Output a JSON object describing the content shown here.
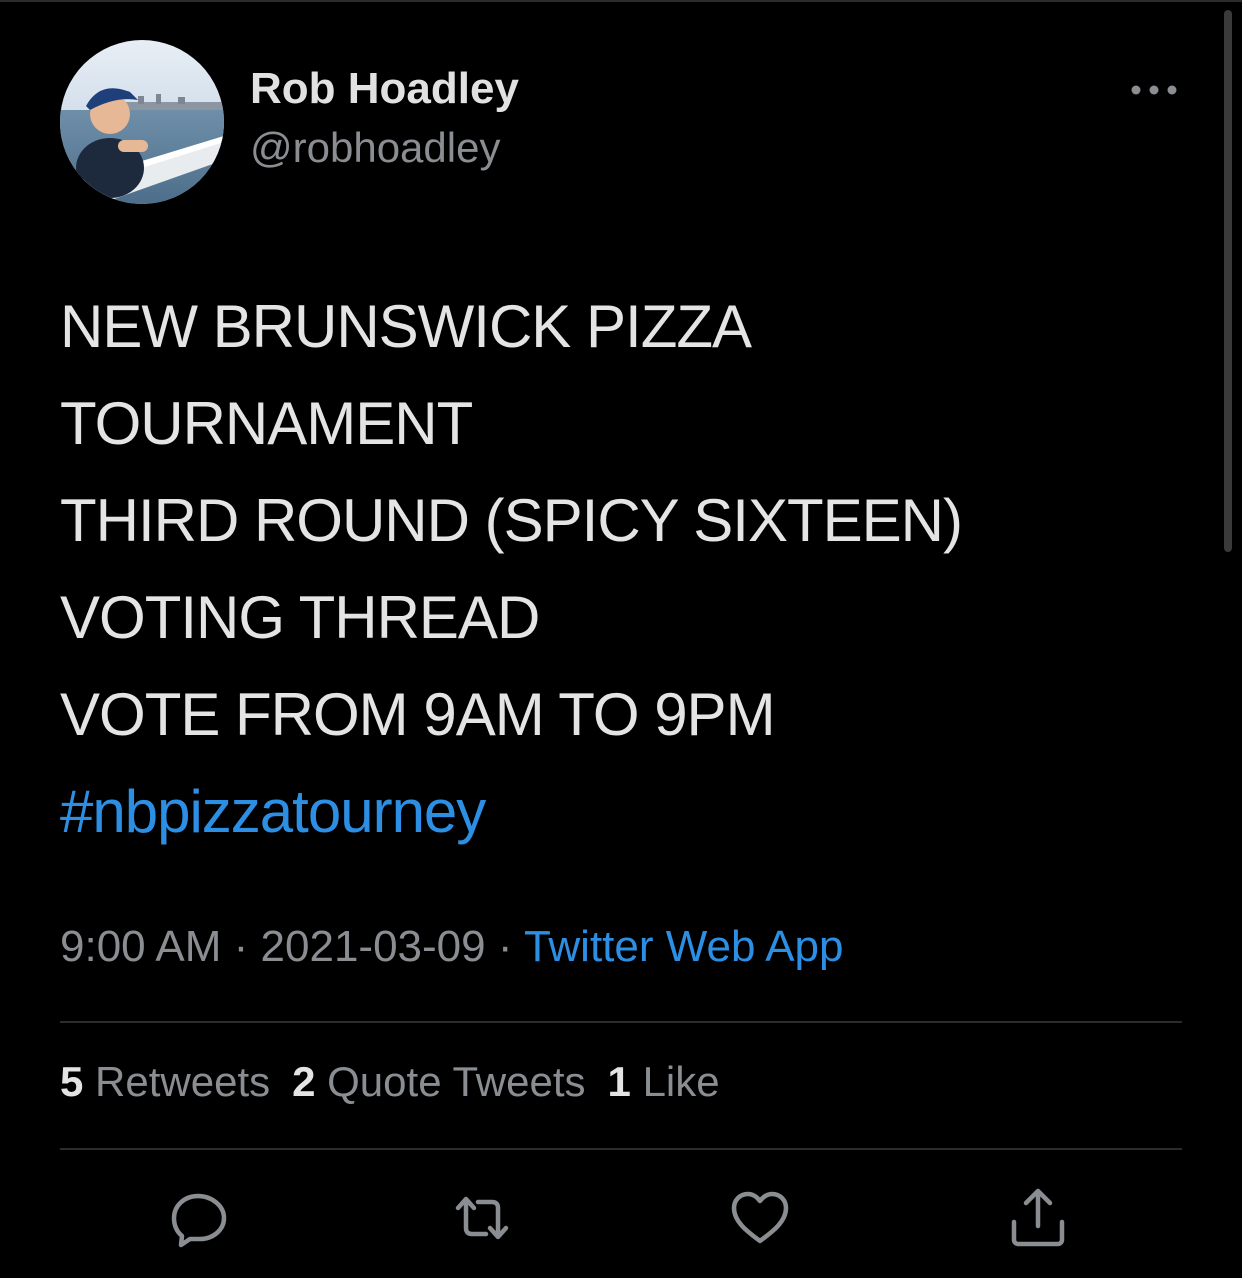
{
  "author": {
    "name": "Rob Hoadley",
    "handle": "@robhoadley"
  },
  "tweet": {
    "lines": [
      "NEW BRUNSWICK PIZZA",
      "TOURNAMENT",
      "THIRD ROUND (SPICY SIXTEEN)",
      "VOTING THREAD",
      "VOTE FROM 9AM TO 9PM"
    ],
    "hashtag": "#nbpizzatourney",
    "time": "9:00 AM",
    "separator": " · ",
    "date": "2021-03-09",
    "source": "Twitter Web App"
  },
  "stats": {
    "retweets": {
      "count": "5",
      "label": "Retweets"
    },
    "quote_tweets": {
      "count": "2",
      "label": "Quote Tweets"
    },
    "likes": {
      "count": "1",
      "label": "Like"
    }
  },
  "actions": {
    "reply": "reply-icon",
    "retweet": "retweet-icon",
    "like": "heart-icon",
    "share": "share-icon",
    "more": "more-dots-icon"
  },
  "colors": {
    "background": "#000000",
    "text": "#e4e4e4",
    "secondary": "#8a8d91",
    "link": "#2c8fe4",
    "divider": "#2a2d30"
  }
}
